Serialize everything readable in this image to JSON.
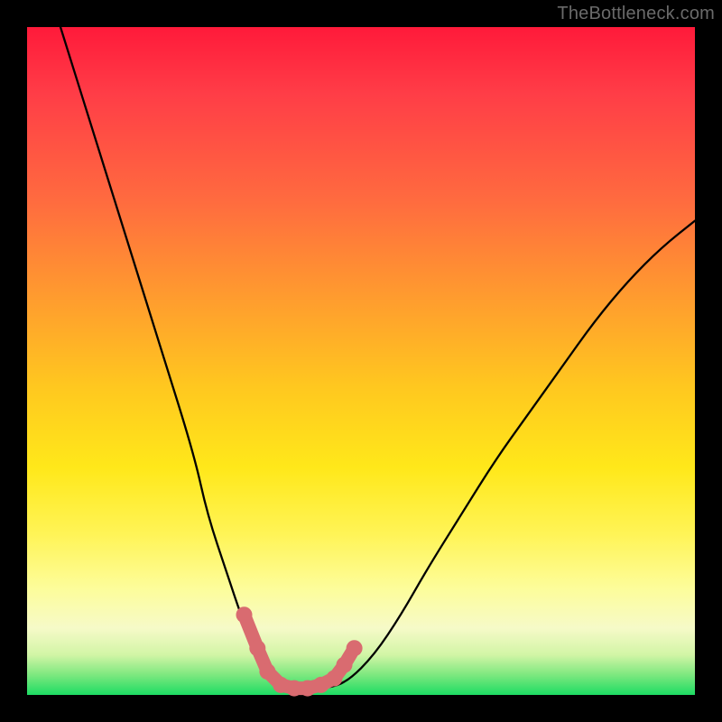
{
  "watermark": "TheBottleneck.com",
  "chart_data": {
    "type": "line",
    "title": "",
    "xlabel": "",
    "ylabel": "",
    "xlim": [
      0,
      100
    ],
    "ylim": [
      0,
      100
    ],
    "grid": false,
    "legend": false,
    "background": "rainbow-vertical",
    "series": [
      {
        "name": "bottleneck-curve",
        "x": [
          5,
          10,
          15,
          20,
          25,
          27,
          30,
          32,
          34,
          36,
          38,
          40,
          42,
          45,
          48,
          52,
          56,
          60,
          65,
          70,
          75,
          80,
          85,
          90,
          95,
          100
        ],
        "y": [
          100,
          84,
          68,
          52,
          36,
          27,
          18,
          12,
          7,
          4,
          2,
          1,
          1,
          1,
          2,
          6,
          12,
          19,
          27,
          35,
          42,
          49,
          56,
          62,
          67,
          71
        ]
      }
    ],
    "marked_points": {
      "name": "highlight-dots",
      "color": "#d96b70",
      "x": [
        32.5,
        34.5,
        36,
        38,
        40,
        42,
        44,
        46,
        47.5,
        49
      ],
      "y": [
        12,
        7,
        3.5,
        1.5,
        1,
        1,
        1.5,
        2.5,
        4.5,
        7
      ]
    }
  }
}
